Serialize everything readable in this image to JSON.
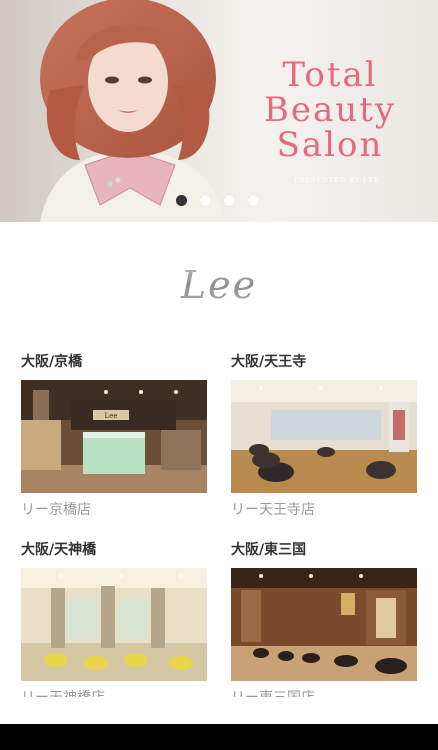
{
  "hero": {
    "title_lines": [
      "Total",
      "Beauty",
      "Salon"
    ],
    "subtitle": "PRESENTED BY LEE",
    "slide_count": 4,
    "active_slide": 1,
    "title_color": "#e56b7c"
  },
  "brand": {
    "logo_text": "Lee"
  },
  "salons": [
    {
      "region": "大阪/京橋",
      "store": "リー京橋店"
    },
    {
      "region": "大阪/天王寺",
      "store": "リー天王寺店"
    },
    {
      "region": "大阪/天神橋",
      "store": "リー天神橋店"
    },
    {
      "region": "大阪/東三国",
      "store": "リー東三国店"
    }
  ]
}
